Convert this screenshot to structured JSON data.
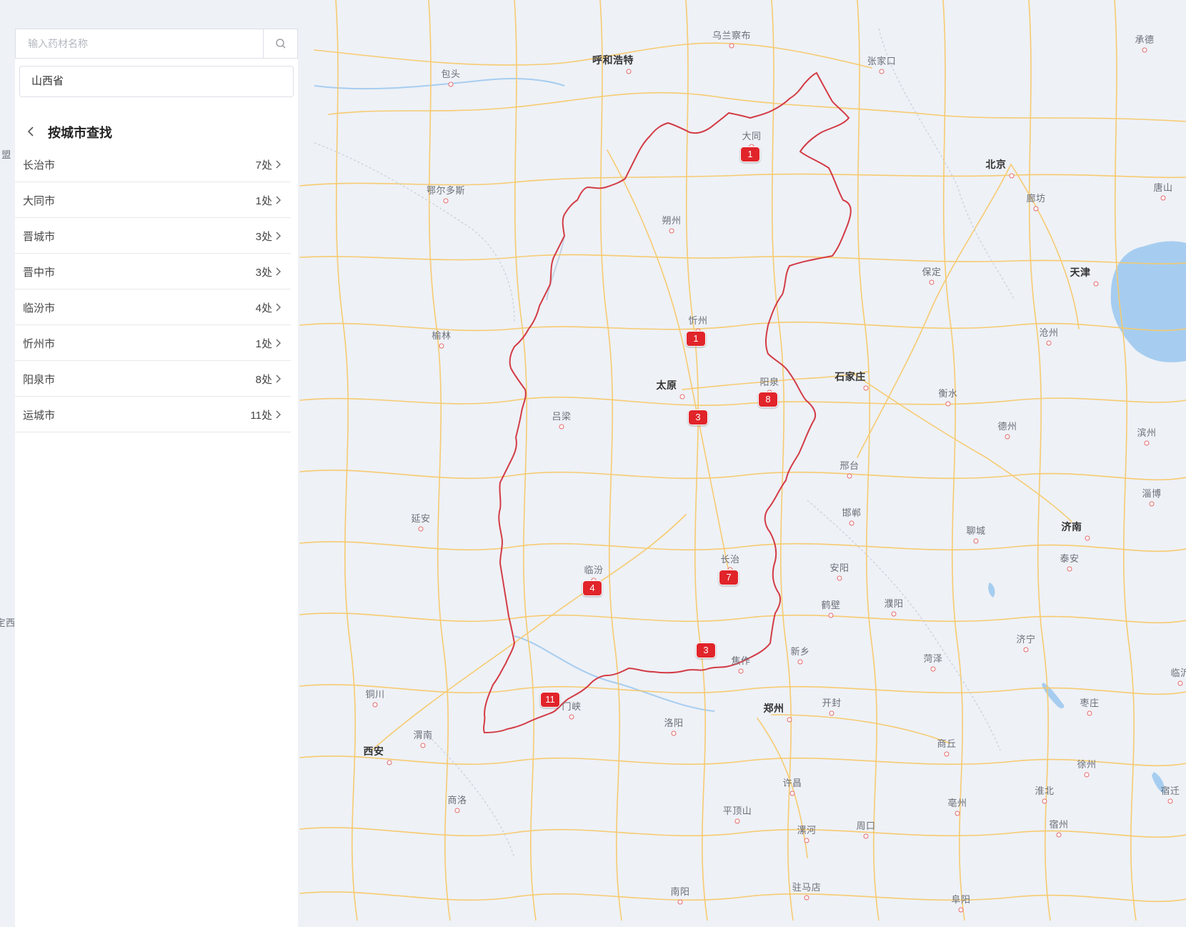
{
  "search": {
    "placeholder": "输入药材名称",
    "icon": "search-icon"
  },
  "region": {
    "value": "山西省"
  },
  "panel": {
    "title": "按城市查找",
    "cities": [
      {
        "name": "长治市",
        "count": "7处"
      },
      {
        "name": "大同市",
        "count": "1处"
      },
      {
        "name": "晋城市",
        "count": "3处"
      },
      {
        "name": "晋中市",
        "count": "3处"
      },
      {
        "name": "临汾市",
        "count": "4处"
      },
      {
        "name": "忻州市",
        "count": "1处"
      },
      {
        "name": "阳泉市",
        "count": "8处"
      },
      {
        "name": "运城市",
        "count": "11处"
      }
    ]
  },
  "map": {
    "colors": {
      "background": "#eef1f6",
      "road": "#f7c96a",
      "border": "#d33b45",
      "marker": "#e0242a",
      "water": "#a6cdf0"
    },
    "labels": {
      "huhehaote": "呼和浩特",
      "wulanchabu": "乌兰察布",
      "baotou": "包头",
      "zhangjiakou": "张家口",
      "chengde": "承德",
      "beijing": "北京",
      "datong": "大同",
      "eerduosi": "鄂尔多斯",
      "shuozhou": "朔州",
      "langfang": "廊坊",
      "tangshan": "唐山",
      "tianjin": "天津",
      "baoding": "保定",
      "cangzhou": "沧州",
      "xinzhou": "忻州",
      "yulin": "榆林",
      "taiyuan": "太原",
      "yangquan": "阳泉",
      "shijiazhuang": "石家庄",
      "hengshui": "衡水",
      "lvliang": "吕梁",
      "dezhou": "德州",
      "binzhou": "滨州",
      "xingtai": "邢台",
      "zibo": "淄博",
      "handan": "邯郸",
      "yanan": "延安",
      "jinan": "济南",
      "liaocheng": "聊城",
      "changzhi": "长治",
      "linfen": "临汾",
      "anyang": "安阳",
      "taian": "泰安",
      "hebi": "鹤壁",
      "puyang": "濮阳",
      "jining": "济宁",
      "jiaozuo": "焦作",
      "xinxiang": "新乡",
      "heze": "菏泽",
      "linyi": "临沂",
      "tongchuan": "铜川",
      "sanmenxia": "门峡",
      "kaifeng": "开封",
      "zhengzhou": "郑州",
      "zaozhuang": "枣庄",
      "luoyang": "洛阳",
      "weinan": "渭南",
      "xian": "西安",
      "shangqiu": "商丘",
      "xuzhou": "徐州",
      "xuchang": "许昌",
      "shangluo": "商洛",
      "huaibei": "淮北",
      "suqian": "宿迁",
      "bozhou": "亳州",
      "pingdingshan": "平顶山",
      "luohe": "漯河",
      "zhoukou": "周口",
      "suzhou": "宿州",
      "zhumadian": "驻马店",
      "nanyang": "南阳",
      "fuyang": "阜阳",
      "edge_meng": "盟",
      "edge_dingxi": "定西"
    },
    "markers": [
      {
        "city": "大同",
        "count": "1"
      },
      {
        "city": "忻州",
        "count": "1"
      },
      {
        "city": "阳泉",
        "count": "8"
      },
      {
        "city": "晋中",
        "count": "3"
      },
      {
        "city": "临汾",
        "count": "4"
      },
      {
        "city": "长治",
        "count": "7"
      },
      {
        "city": "晋城",
        "count": "3"
      },
      {
        "city": "运城",
        "count": "11"
      }
    ]
  }
}
